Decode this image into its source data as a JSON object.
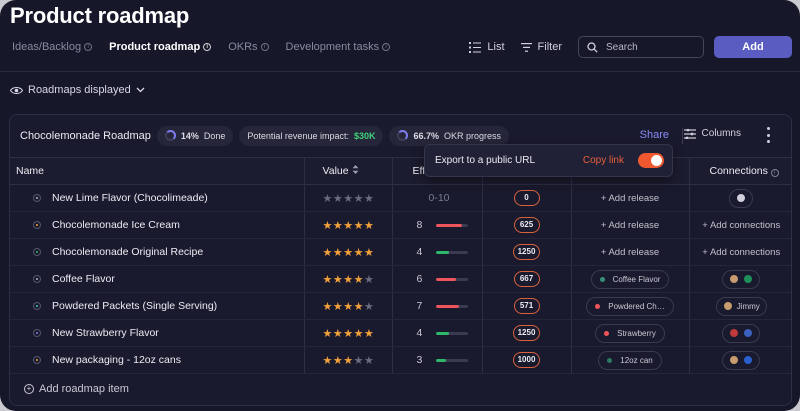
{
  "page": {
    "title": "Product roadmap"
  },
  "tabs": [
    {
      "label": "Ideas/Backlog",
      "active": false
    },
    {
      "label": "Product roadmap",
      "active": true
    },
    {
      "label": "OKRs",
      "active": false
    },
    {
      "label": "Development tasks",
      "active": false
    }
  ],
  "toolbar": {
    "list_label": "List",
    "filter_label": "Filter",
    "search_placeholder": "Search",
    "add_label": "Add"
  },
  "roadmaps_displayed": "Roadmaps displayed",
  "roadmap": {
    "name": "Chocolemonade Roadmap",
    "done_pct": "14%",
    "done_label": "Done",
    "revenue_label": "Potential revenue impact:",
    "revenue_value": "$30K",
    "okr_pct": "66.7%",
    "okr_label": "OKR progress",
    "share_label": "Share",
    "columns_label": "Columns"
  },
  "popup": {
    "label": "Export to a public URL",
    "copy_label": "Copy link",
    "enabled": true
  },
  "table": {
    "headers": {
      "name": "Name",
      "value": "Value",
      "effort": "Eff",
      "connections": "Connections"
    },
    "rows": [
      {
        "name": "New Lime Flavor (Chocolimeade)",
        "dot": "#b8b8c8",
        "stars": 0,
        "effort": "0-10",
        "effort_pct": null,
        "bar_color": "",
        "score": "0",
        "release": null,
        "connections": null,
        "conn_avatars": [
          "#d0d0dc"
        ]
      },
      {
        "name": "Chocolemonade Ice Cream",
        "dot": "#f3a13b",
        "stars": 5,
        "effort": "8",
        "effort_pct": 0.8,
        "bar_color": "#f0545b",
        "score": "625",
        "release": null,
        "connections": "+ Add connections",
        "conn_avatars": []
      },
      {
        "name": "Chocolemonade Original Recipe",
        "dot": "#2fb86a",
        "stars": 5,
        "effort": "4",
        "effort_pct": 0.4,
        "bar_color": "#2fb86a",
        "score": "1250",
        "release": null,
        "connections": "+ Add connections",
        "conn_avatars": []
      },
      {
        "name": "Coffee Flavor",
        "dot": "#b8b8c8",
        "stars": 4,
        "effort": "6",
        "effort_pct": 0.6,
        "bar_color": "#f0545b",
        "score": "667",
        "release": {
          "label": "Coffee Flavor",
          "color": "#3a8f7a"
        },
        "connections": null,
        "conn_avatars": [
          "#c89a70",
          "#1f8f5a"
        ]
      },
      {
        "name": "Powdered Packets (Single Serving)",
        "dot": "#3fd0c8",
        "stars": 4,
        "effort": "7",
        "effort_pct": 0.7,
        "bar_color": "#f0545b",
        "score": "571",
        "release": {
          "label": "Powdered Ch…",
          "color": "#f0545b"
        },
        "connections": "Jimmy",
        "conn_avatars": [
          "#c89a70"
        ]
      },
      {
        "name": "New Strawberry Flavor",
        "dot": "#7c7cf0",
        "stars": 5,
        "effort": "4",
        "effort_pct": 0.4,
        "bar_color": "#2fb86a",
        "score": "1250",
        "release": {
          "label": "Strawberry",
          "color": "#f0545b"
        },
        "connections": null,
        "conn_avatars": [
          "#c03a3a",
          "#3a60c0"
        ]
      },
      {
        "name": "New packaging - 12oz cans",
        "dot": "#f3a13b",
        "stars": 3,
        "effort": "3",
        "effort_pct": 0.3,
        "bar_color": "#2fb86a",
        "score": "1000",
        "release": {
          "label": "12oz can",
          "color": "#2a7a60"
        },
        "connections": null,
        "conn_avatars": [
          "#c89a70",
          "#2a60d0"
        ]
      }
    ],
    "add_release_label": "+ Add release",
    "add_item_label": "Add roadmap item"
  },
  "colors": {
    "accent": "#5b5cc2",
    "share": "#8a8cf5",
    "copy": "#e8603b",
    "toggle": "#f0592f",
    "star": "#f3a13b"
  }
}
